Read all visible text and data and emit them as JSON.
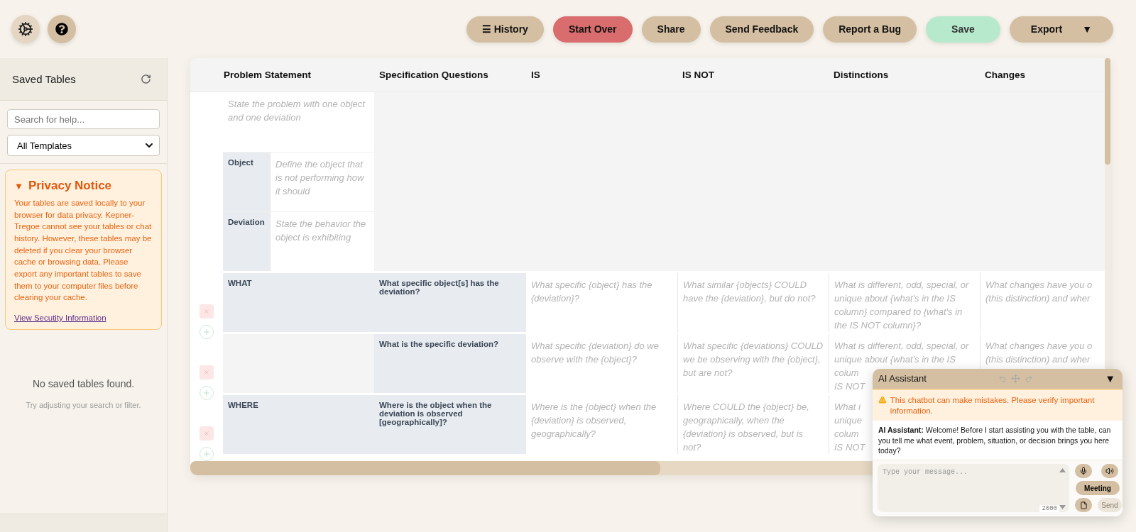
{
  "toolbar": {
    "buttons": [
      {
        "label": "☰ History",
        "kind": "default"
      },
      {
        "label": "Start Over",
        "kind": "danger"
      },
      {
        "label": "Share",
        "kind": "default"
      },
      {
        "label": "Send Feedback",
        "kind": "default"
      },
      {
        "label": "Report a Bug",
        "kind": "default"
      },
      {
        "label": "Save",
        "kind": "success"
      },
      {
        "label": "Export",
        "kind": "default",
        "caret": "▼"
      }
    ]
  },
  "sidebar": {
    "title": "Saved Tables",
    "search": {
      "placeholder": "Search for help..."
    },
    "template_select": {
      "value": "All Templates"
    },
    "privacy_notice": {
      "marker": "▼",
      "title": "Privacy Notice",
      "body": "Your tables are saved locally to your browser for data privacy. Kepner-Tregoe cannot see your tables or chat history. However, these tables may be deleted if you clear your browser cache or browsing data. Please export any important tables to save them to your computer files before clearing your cache.",
      "link": "View Secutity Information"
    },
    "empty_state": {
      "title": "No saved tables found.",
      "hint": "Try adjusting your search or filter."
    }
  },
  "table": {
    "columns": [
      "Problem Statement",
      "Specification Questions",
      "IS",
      "IS NOT",
      "Distinctions",
      "Changes"
    ],
    "problem_statement": {
      "placeholder": "State the problem with one object and one deviation",
      "fields": [
        {
          "label": "Object",
          "placeholder": "Define the object that is not performing how it should"
        },
        {
          "label": "Deviation",
          "placeholder": "State the behavior the object is exhibiting"
        }
      ]
    },
    "rows": [
      {
        "cells": [
          {
            "text": "WHAT"
          },
          {
            "text": "What specific object[s] has the deviation?"
          },
          {
            "placeholder": "What specific {object} has the {deviation}?"
          },
          {
            "placeholder": "What similar {objects} COULD have the {deviation}, but do not?"
          },
          {
            "placeholder": "What is different, odd, special, or unique about {what's in the IS column} compared to {what's in the IS NOT column}?"
          },
          {
            "placeholder": "What changes have you o\n(this distinction) and wher"
          }
        ]
      },
      {
        "cells": [
          {
            "text": ""
          },
          {
            "text": "What is the specific deviation?"
          },
          {
            "placeholder": "What specific {deviation} do we observe with the {object}?"
          },
          {
            "placeholder": "What specific {deviations} COULD we be observing with the {object}, but are not?"
          },
          {
            "placeholder": "What is different, odd, special, or\nunique about {what's in the IS\ncolum\nIS NOT"
          },
          {
            "placeholder": "What changes have you o\n(this distinction) and wher"
          }
        ]
      },
      {
        "cells": [
          {
            "text": "WHERE"
          },
          {
            "text": "Where is the object when the deviation is observed [geographically]?"
          },
          {
            "placeholder": "Where is the {object} when the {deviation} is observed, geographically?"
          },
          {
            "placeholder": "Where COULD the {object} be, geographically, when the {deviation} is observed, but is not?"
          },
          {
            "placeholder": "What i\nunique\ncolum\nIS NOT"
          }
        ]
      }
    ]
  },
  "chat": {
    "title": "AI Assistant",
    "collapse": "▼",
    "warning": "This chatbot can make mistakes. Please verify important information.",
    "messages": [
      {
        "text": "**AI Assistant:** Welcome! Before I start assisting you with the table, can you tell me what event, problem, situation, or decision brings you here today?"
      }
    ],
    "input": {
      "placeholder": "Type your message..."
    },
    "counter": "2000",
    "meeting": "Meeting",
    "send": {
      "label": "Send",
      "disabled": true
    }
  }
}
